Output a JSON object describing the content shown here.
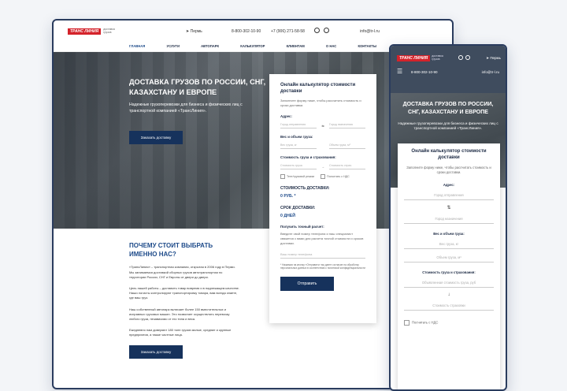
{
  "brand": {
    "logo_text": "ТРАНС ЛИНИЯ",
    "logo_sub": "доставка грузов",
    "accent": "#d4232b",
    "primary": "#16325c"
  },
  "topbar": {
    "city": "Пермь",
    "phone1": "8-800-302-10-90",
    "phone2": "+7 (906) 271-58-58",
    "email": "info@tr-l.ru"
  },
  "nav": [
    "ГЛАВНАЯ",
    "УСЛУГИ",
    "АВТОПАРК",
    "КАЛЬКУЛЯТОР",
    "КЛИЕНТАМ",
    "О НАС",
    "КОНТАКТЫ"
  ],
  "hero": {
    "title": "ДОСТАВКА ГРУЗОВ ПО РОССИИ, СНГ, КАЗАХСТАНУ И ЕВРОПЕ",
    "subtitle": "Надежные грузоперевозки для бизнеса и физических лиц с транспортной компанией «ТрансЛиния».",
    "cta": "Заказать доставку"
  },
  "calc": {
    "title": "Онлайн калькулятор стоимости доставки",
    "subtitle": "Заполните форму ниже, чтобы рассчитать стоимость и сроки доставки.",
    "address_label": "Адрес:",
    "from_ph": "Город отправления",
    "to_ph": "Город назначения",
    "weight_label": "Вес и объем груза:",
    "weight_ph": "Вес груза, кг",
    "volume_ph": "Объем груза, м³",
    "value_label": "Стоимость груза и страхования:",
    "value_ph": "Стоимость груза",
    "insure_ph": "Стоимость страх.",
    "check1": "Тент/грузовой режим",
    "check2": "Посчитать с НДС",
    "cost_label": "СТОИМОСТЬ ДОСТАВКИ:",
    "cost_value": "0 РУБ. *",
    "term_label": "СРОК ДОСТАВКИ:",
    "term_value": "0 ДНЕЙ",
    "exact_label": "Получить точный расчет:",
    "exact_text": "Введите свой номер телефона и наш специалист свяжется с вами для расчета точной стоимости и сроков доставки.",
    "phone_ph": "Ваш номер телефона",
    "note": "* Нажимая на кнопку «Отправить» вы даете согласие на обработку персональных данных в соответствии с политикой конфиденциальности",
    "submit": "Отправить"
  },
  "why": {
    "title": "ПОЧЕМУ СТОИТ ВЫБРАТЬ ИМЕННО НАС?",
    "p1": "«ТрансЛиния» – транспортная компания, открытая в 2006 году в Перми. Мы занимаемся доставкой сборных грузов автотранспортом по территории России, СНГ и Европы от двери до двери.",
    "p2": "Цель нашей работы – доставить товар вовремя и в надлежащем качестве. Наши логисты контролируют транспортировку товара, вам всегда знаете, где ваш груз.",
    "p3": "Наш собственный автопарк включает более 150 вместительных и исправных грузовых машин. Это позволяет осуществлять перевозку любого груза, независимо от его типа и веса.",
    "p4": "Ежедневно нам доверяют 180 тонн грузов малые, средние и крупные предприятия, а также частные лица.",
    "cta": "Заказать доставку"
  },
  "mobile": {
    "calc_title": "Онлайн калькулятор стоимости доставки",
    "calc_sub": "Заполните форму ниже, чтобы рассчитать стоимость и сроки доставки.",
    "from_ph": "Город отправления",
    "to_ph": "Город назначения",
    "weight_ph": "Вес груза, кг",
    "volume_ph": "Объем груза, м³",
    "value_ph": "Объявленная стоимость груза, руб",
    "insure_ph": "Стоимость страховки",
    "nds": "Посчитать с НДС"
  }
}
